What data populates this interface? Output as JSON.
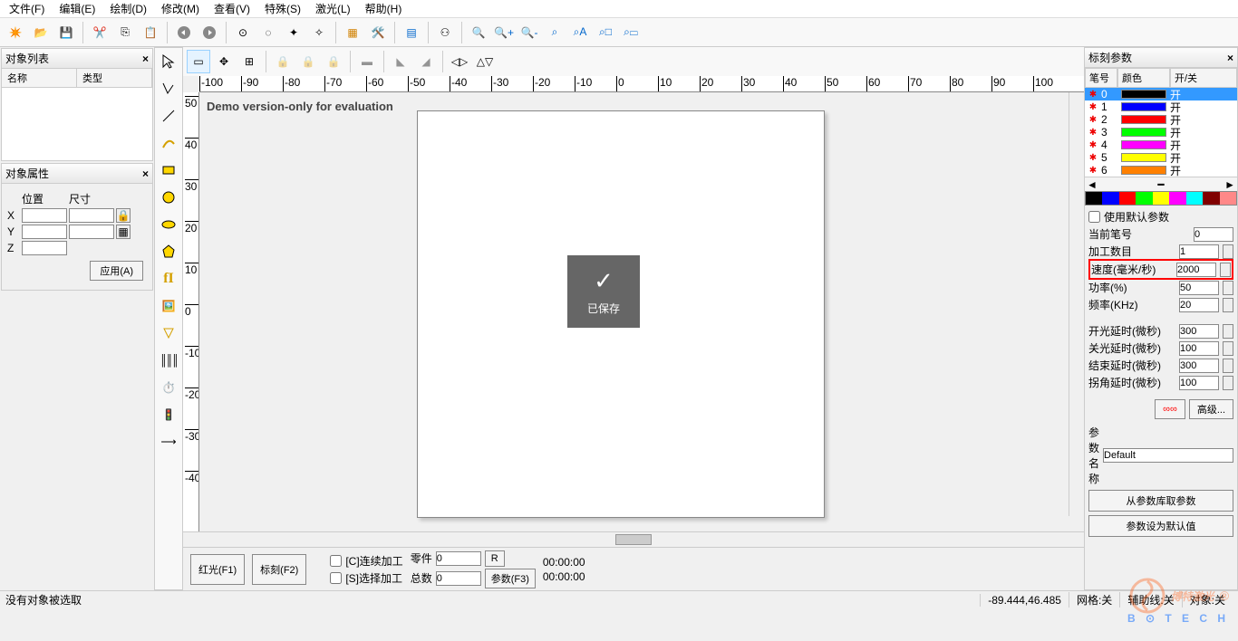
{
  "menu": {
    "items": [
      "文件(F)",
      "编辑(E)",
      "绘制(D)",
      "修改(M)",
      "查看(V)",
      "特殊(S)",
      "激光(L)",
      "帮助(H)"
    ]
  },
  "left": {
    "obj_list": {
      "title": "对象列表",
      "col1": "名称",
      "col2": "类型"
    },
    "obj_prop": {
      "title": "对象属性",
      "pos": "位置",
      "size": "尺寸",
      "x": "X",
      "y": "Y",
      "z": "Z",
      "apply": "应用(A)"
    }
  },
  "canvas": {
    "demo": "Demo version-only for evaluation",
    "saved": "已保存",
    "ruler_h": [
      "-100",
      "-90",
      "-80",
      "-70",
      "-60",
      "-50",
      "-40",
      "-30",
      "-20",
      "-10",
      "0",
      "10",
      "20",
      "30",
      "40",
      "50",
      "60",
      "70",
      "80",
      "90",
      "100"
    ],
    "ruler_v": [
      "50",
      "40",
      "30",
      "20",
      "10",
      "0",
      "-10",
      "-20",
      "-30",
      "-40"
    ]
  },
  "bottom": {
    "red": "红光(F1)",
    "mark": "标刻(F2)",
    "cont": "[C]连续加工",
    "sel": "[S]选择加工",
    "part": "零件",
    "total": "总数",
    "part_val": "0",
    "total_val": "0",
    "r_btn": "R",
    "param_btn": "参数(F3)",
    "time1": "00:00:00",
    "time2": "00:00:00"
  },
  "status": {
    "msg": "没有对象被选取",
    "coord": "-89.444,46.485",
    "grid": "网格:关",
    "guide": "辅助线:关",
    "obj": "对象:关"
  },
  "right": {
    "title": "标刻参数",
    "hdr_pen": "笔号",
    "hdr_color": "颜色",
    "hdr_onoff": "开/关",
    "pens": [
      {
        "n": "0",
        "c": "#000000",
        "s": "开",
        "sel": true
      },
      {
        "n": "1",
        "c": "#0000ff",
        "s": "开"
      },
      {
        "n": "2",
        "c": "#ff0000",
        "s": "开"
      },
      {
        "n": "3",
        "c": "#00ff00",
        "s": "开"
      },
      {
        "n": "4",
        "c": "#ff00ff",
        "s": "开"
      },
      {
        "n": "5",
        "c": "#ffff00",
        "s": "开"
      },
      {
        "n": "6",
        "c": "#ff8000",
        "s": "开"
      }
    ],
    "colorstrip": [
      "#000",
      "#00f",
      "#f00",
      "#0f0",
      "#ff0",
      "#f0f",
      "#0ff",
      "#800000",
      "#f88"
    ],
    "use_default": "使用默认参数",
    "cur_pen": "当前笔号",
    "cur_pen_v": "0",
    "count": "加工数目",
    "count_v": "1",
    "speed": "速度(毫米/秒)",
    "speed_v": "2000",
    "power": "功率(%)",
    "power_v": "50",
    "freq": "频率(KHz)",
    "freq_v": "20",
    "on_delay": "开光延时(微秒)",
    "on_delay_v": "300",
    "off_delay": "关光延时(微秒)",
    "off_delay_v": "100",
    "end_delay": "结束延时(微秒)",
    "end_delay_v": "300",
    "corner_delay": "拐角延时(微秒)",
    "corner_delay_v": "100",
    "advanced": "高级...",
    "param_name_lbl": "参数名称",
    "param_name_v": "Default",
    "from_lib": "从参数库取参数",
    "set_default": "参数设为默认值"
  },
  "watermark": {
    "main": "博特激光",
    "sub": "B ⊙ T E C H",
    "reg": "®"
  }
}
